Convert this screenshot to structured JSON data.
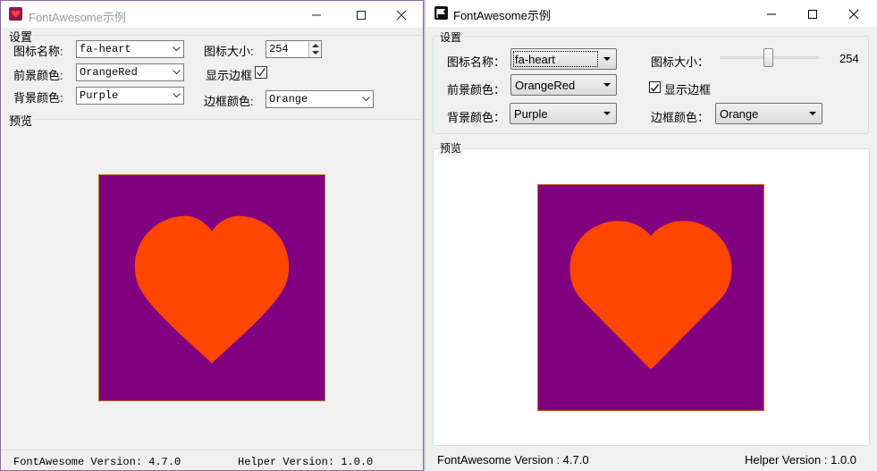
{
  "left_window": {
    "title": "FontAwesome示例",
    "settings_label": "设置",
    "icon_name_label": "图标名称:",
    "icon_name_value": "fa-heart",
    "icon_size_label": "图标大小:",
    "icon_size_value": "254",
    "fg_color_label": "前景颜色:",
    "fg_color_value": "OrangeRed",
    "show_border_label": "显示边框",
    "show_border_checked": true,
    "bg_color_label": "背景颜色:",
    "bg_color_value": "Purple",
    "border_color_label": "边框颜色:",
    "border_color_value": "Orange",
    "preview_label": "预览",
    "status_fa_version": "FontAwesome Version: 4.7.0",
    "status_helper_version": "Helper Version: 1.0.0"
  },
  "right_window": {
    "title": "FontAwesome示例",
    "settings_label": "设置",
    "icon_name_label": "图标名称：",
    "icon_name_value": "fa-heart",
    "icon_size_label": "图标大小：",
    "icon_size_value": "254",
    "icon_size_fraction": 0.48,
    "fg_color_label": "前景颜色：",
    "fg_color_value": "OrangeRed",
    "show_border_label": "显示边框",
    "show_border_checked": true,
    "bg_color_label": "背景颜色：",
    "bg_color_value": "Purple",
    "border_color_label": "边框颜色：",
    "border_color_value": "Orange",
    "preview_label": "预览",
    "status_fa_version": "FontAwesome Version : 4.7.0",
    "status_helper_version": "Helper Version : 1.0.0"
  },
  "colors": {
    "heart": "#FF4500",
    "background": "#800080",
    "border": "#FFA500"
  },
  "icons": {
    "left_app_icon": "heart-icon",
    "right_app_icon": "flag-icon",
    "preview_icon": "heart-icon"
  }
}
